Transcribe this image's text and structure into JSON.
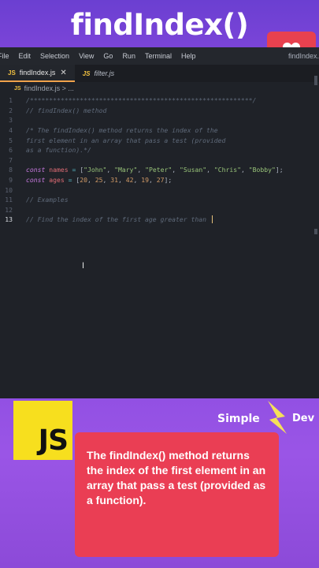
{
  "headline": "findIndex()",
  "editor": {
    "menu": [
      "File",
      "Edit",
      "Selection",
      "View",
      "Go",
      "Run",
      "Terminal",
      "Help"
    ],
    "window_title": "findIndex.",
    "tabs": [
      {
        "label": "findIndex.js",
        "icon": "js-icon",
        "active": true
      },
      {
        "label": "filter.js",
        "icon": "js-icon",
        "active": false
      }
    ],
    "breadcrumb": "findIndex.js > ...",
    "lines": [
      {
        "n": "1",
        "tokens": [
          {
            "t": "cm",
            "v": "/**********************************************************/"
          }
        ]
      },
      {
        "n": "2",
        "tokens": [
          {
            "t": "cm",
            "v": "// findIndex() method"
          }
        ]
      },
      {
        "n": "3",
        "tokens": []
      },
      {
        "n": "4",
        "tokens": [
          {
            "t": "cm",
            "v": "/* The findIndex() method returns the index of the"
          }
        ]
      },
      {
        "n": "5",
        "tokens": [
          {
            "t": "cm",
            "v": "first element in an array that pass a test (provided"
          }
        ]
      },
      {
        "n": "6",
        "tokens": [
          {
            "t": "cm",
            "v": "as a function).*/"
          }
        ]
      },
      {
        "n": "7",
        "tokens": []
      },
      {
        "n": "8",
        "tokens": [
          {
            "t": "kw",
            "v": "const "
          },
          {
            "t": "id",
            "v": "names"
          },
          {
            "t": "op",
            "v": " = "
          },
          {
            "t": "pn",
            "v": "["
          },
          {
            "t": "str",
            "v": "\"John\""
          },
          {
            "t": "pn",
            "v": ", "
          },
          {
            "t": "str",
            "v": "\"Mary\""
          },
          {
            "t": "pn",
            "v": ", "
          },
          {
            "t": "str",
            "v": "\"Peter\""
          },
          {
            "t": "pn",
            "v": ", "
          },
          {
            "t": "str",
            "v": "\"Susan\""
          },
          {
            "t": "pn",
            "v": ", "
          },
          {
            "t": "str",
            "v": "\"Chris\""
          },
          {
            "t": "pn",
            "v": ", "
          },
          {
            "t": "str",
            "v": "\"Bobby\""
          },
          {
            "t": "pn",
            "v": "];"
          }
        ]
      },
      {
        "n": "9",
        "tokens": [
          {
            "t": "kw",
            "v": "const "
          },
          {
            "t": "id",
            "v": "ages"
          },
          {
            "t": "op",
            "v": " = "
          },
          {
            "t": "pn",
            "v": "["
          },
          {
            "t": "num",
            "v": "20"
          },
          {
            "t": "pn",
            "v": ", "
          },
          {
            "t": "num",
            "v": "25"
          },
          {
            "t": "pn",
            "v": ", "
          },
          {
            "t": "num",
            "v": "31"
          },
          {
            "t": "pn",
            "v": ", "
          },
          {
            "t": "num",
            "v": "42"
          },
          {
            "t": "pn",
            "v": ", "
          },
          {
            "t": "num",
            "v": "19"
          },
          {
            "t": "pn",
            "v": ", "
          },
          {
            "t": "num",
            "v": "27"
          },
          {
            "t": "pn",
            "v": "];"
          }
        ]
      },
      {
        "n": "10",
        "tokens": []
      },
      {
        "n": "11",
        "tokens": [
          {
            "t": "cm",
            "v": "// Examples"
          }
        ]
      },
      {
        "n": "12",
        "tokens": []
      },
      {
        "n": "13",
        "tokens": [
          {
            "t": "cm",
            "v": "// Find the index of the first age greater than "
          }
        ],
        "current": true
      }
    ]
  },
  "js_logo": "JS",
  "brand": {
    "left": "Simple",
    "right": "Dev"
  },
  "caption": "The findIndex() method returns the index of the first element in an array that pass a test (provided as a function).",
  "colors": {
    "badge": "#e8414f",
    "caption_bg": "#ea3e54",
    "js_yellow": "#f7df1e",
    "accent_tab": "#f0a24b"
  }
}
